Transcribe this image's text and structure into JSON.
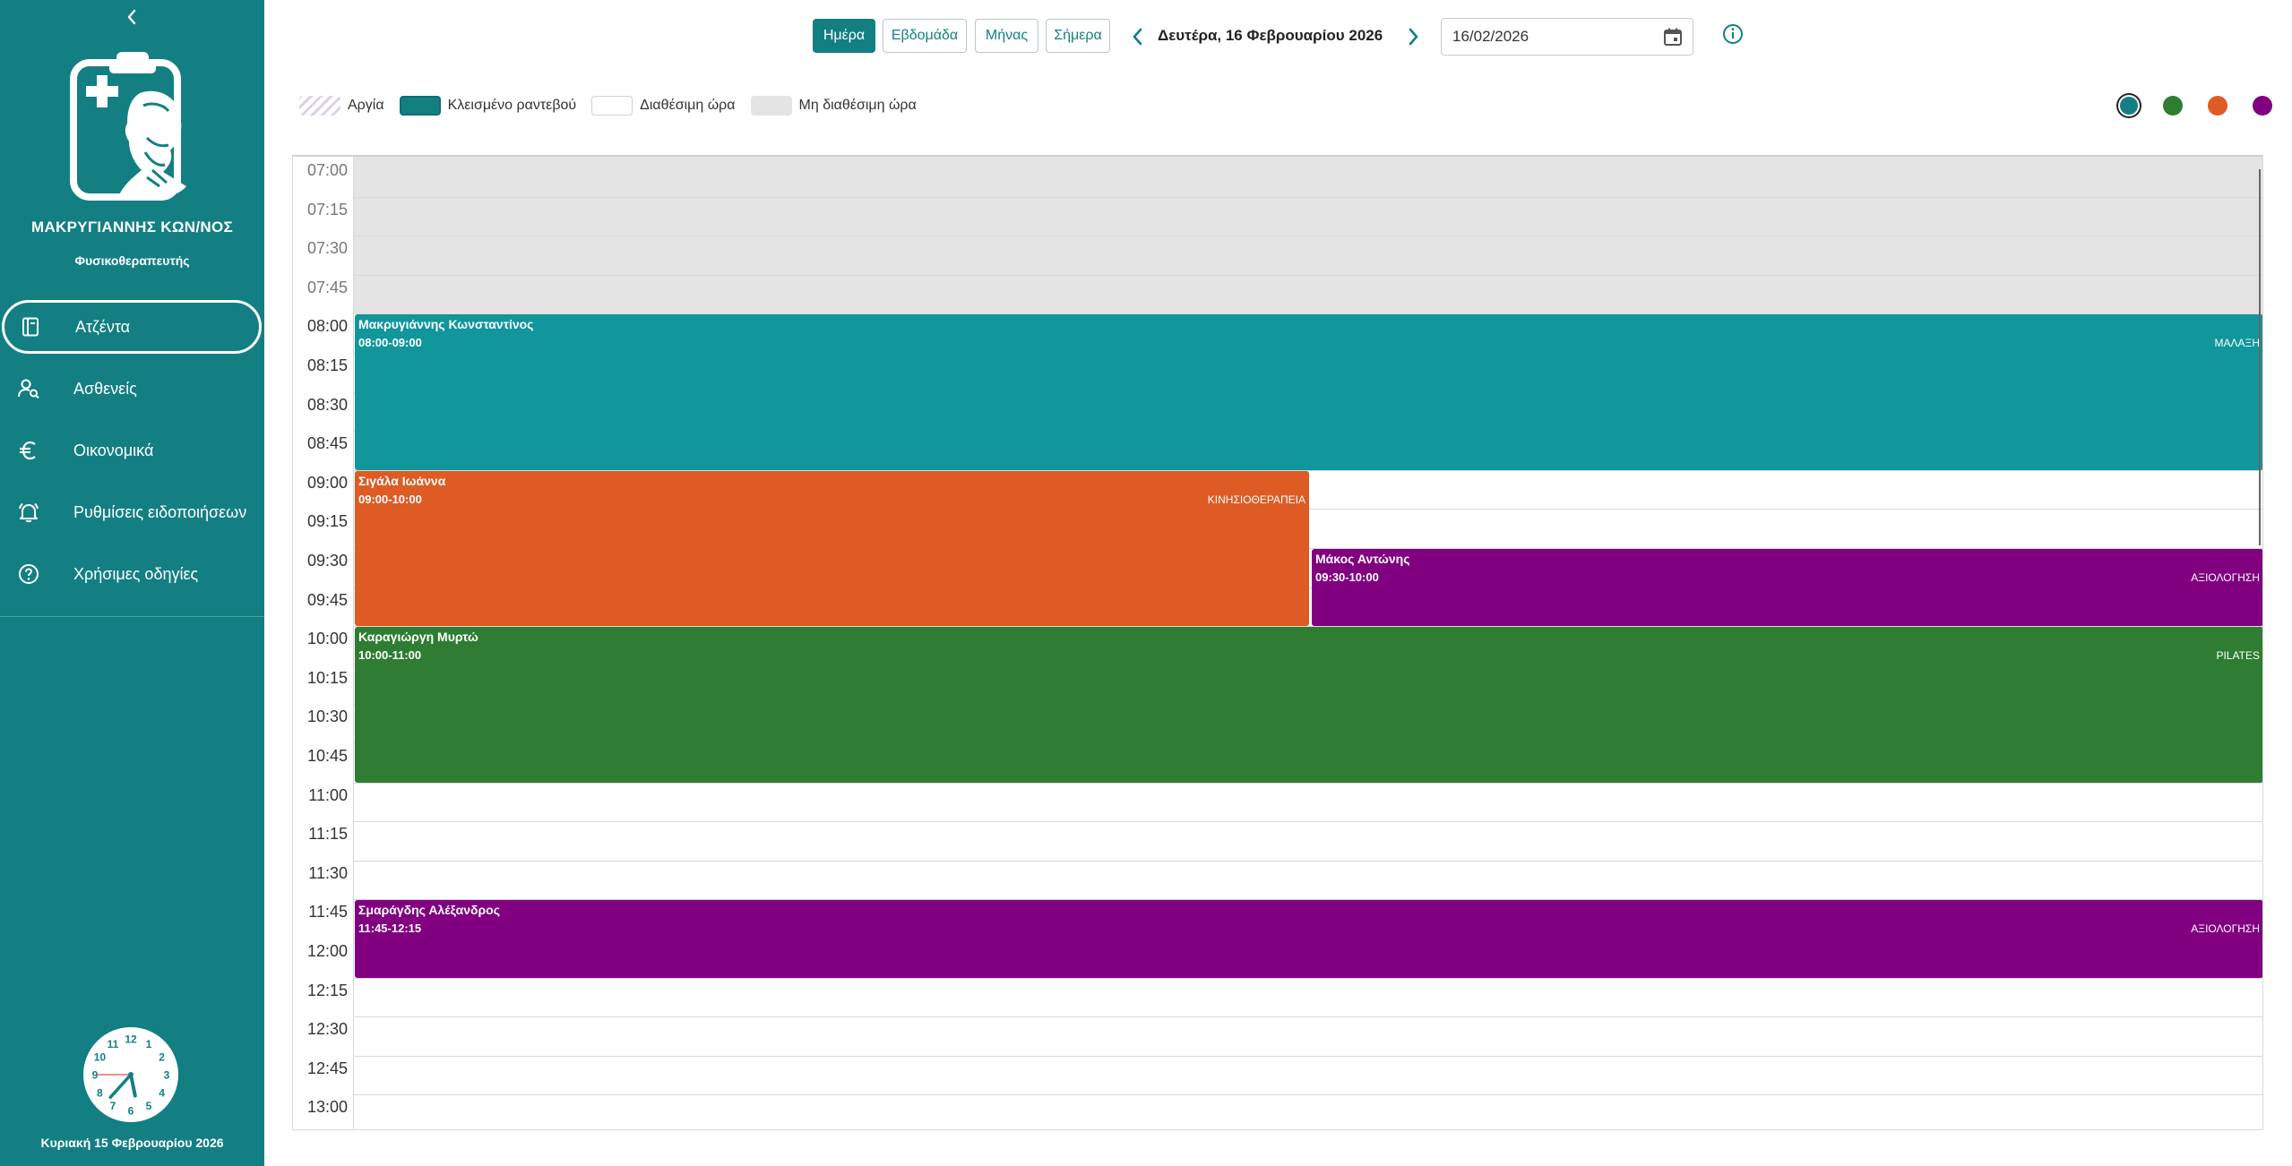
{
  "sidebar": {
    "doctor_name": "ΜΑΚΡΥΓΙΑΝΝΗΣ ΚΩΝ/ΝΟΣ",
    "doctor_role": "Φυσικοθεραπευτής",
    "items": [
      {
        "label": "Ατζέντα",
        "icon": "book-icon"
      },
      {
        "label": "Ασθενείς",
        "icon": "user-search-icon"
      },
      {
        "label": "Οικονομικά",
        "icon": "euro-icon"
      },
      {
        "label": "Ρυθμίσεις ειδοποιήσεων",
        "icon": "bell-icon"
      },
      {
        "label": "Χρήσιμες οδηγίες",
        "icon": "help-circle-icon"
      }
    ],
    "date_label": "Κυριακή 15 Φεβρουαρίου 2026",
    "clock": {
      "hour": 5,
      "minute": 37,
      "second": 45
    }
  },
  "toolbar": {
    "view_day": "Ημέρα",
    "view_week": "Εβδομάδα",
    "view_month": "Μήνας",
    "today": "Σήμερα",
    "current_date": "Δευτέρα, 16 Φεβρουαρίου 2026",
    "date_value": "16/02/2026"
  },
  "legend": {
    "holiday": "Αργία",
    "booked": "Κλεισμένο ραντεβού",
    "available": "Διαθέσιμη ώρα",
    "unavailable": "Μη διαθέσιμη ώρα"
  },
  "colors": {
    "teal": "#137f83",
    "green": "#2e7d32",
    "orange": "#de5b23",
    "purple": "#800080",
    "unavailable": "#e4e4e4"
  },
  "filters": [
    "#137f83",
    "#2e7d32",
    "#de5b23",
    "#800080"
  ],
  "times": [
    "07:00",
    "07:15",
    "07:30",
    "07:45",
    "08:00",
    "08:15",
    "08:30",
    "08:45",
    "09:00",
    "09:15",
    "09:30",
    "09:45",
    "10:00",
    "10:15",
    "10:30",
    "10:45",
    "11:00",
    "11:15",
    "11:30",
    "11:45",
    "12:00",
    "12:15",
    "12:30",
    "12:45",
    "13:00"
  ],
  "unavailable_until": "08:00",
  "events": [
    {
      "name": "Μακρυγιάννης Κωνσταντίνος",
      "time": "08:00-09:00",
      "type": "ΜΑΛΑΞΗ",
      "start": "08:00",
      "end": "09:00",
      "color": "#11969c",
      "column": "full"
    },
    {
      "name": "Σιγάλα Ιωάννα",
      "time": "09:00-10:00",
      "type": "ΚΙΝΗΣΙΟΘΕΡΑΠΕΙΑ",
      "start": "09:00",
      "end": "10:00",
      "color": "#de5b23",
      "column": "left"
    },
    {
      "name": "Μάκος Αντώνης",
      "time": "09:30-10:00",
      "type": "ΑΞΙΟΛΟΓΗΣΗ",
      "start": "09:30",
      "end": "10:00",
      "color": "#800080",
      "column": "right"
    },
    {
      "name": "Καραγιώργη Μυρτώ",
      "time": "10:00-11:00",
      "type": "PILATES",
      "start": "10:00",
      "end": "11:00",
      "color": "#2e7d32",
      "column": "full"
    },
    {
      "name": "Σμαράγδης Αλέξανδρος",
      "time": "11:45-12:15",
      "type": "ΑΞΙΟΛΟΓΗΣΗ",
      "start": "11:45",
      "end": "12:15",
      "color": "#800080",
      "column": "full"
    }
  ]
}
